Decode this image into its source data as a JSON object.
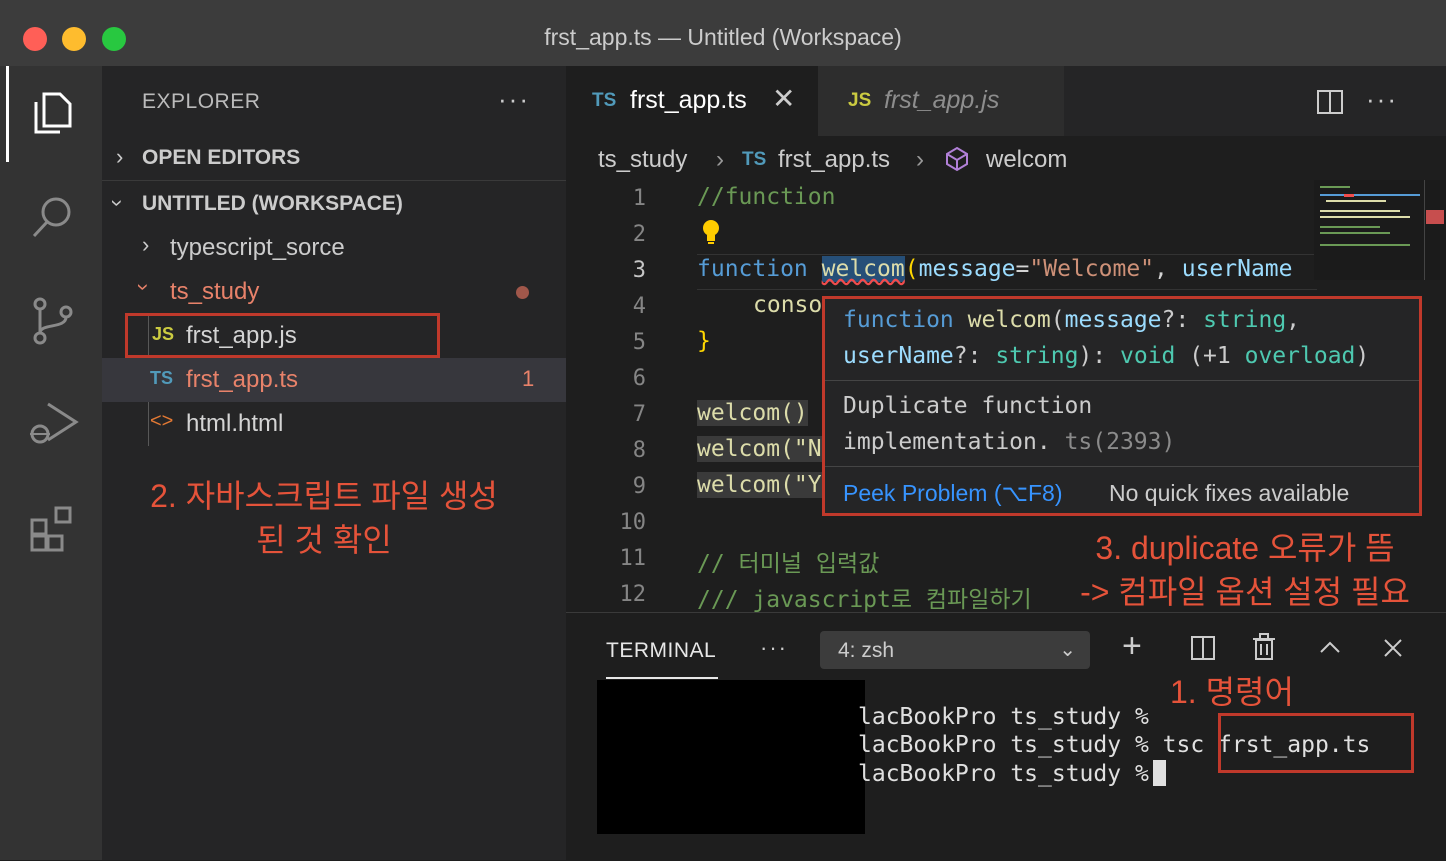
{
  "window": {
    "title": "frst_app.ts — Untitled (Workspace)"
  },
  "sidebar": {
    "title": "EXPLORER",
    "more": "···",
    "open_editors": "OPEN EDITORS",
    "workspace": "UNTITLED (WORKSPACE)",
    "items": [
      {
        "label": "typescript_sorce",
        "type": "folder"
      },
      {
        "label": "ts_study",
        "type": "folder"
      },
      {
        "label": "frst_app.js",
        "icon": "JS"
      },
      {
        "label": "frst_app.ts",
        "icon": "TS",
        "badge": "1"
      },
      {
        "label": "html.html",
        "icon": "<>"
      }
    ]
  },
  "tabs": [
    {
      "label": "frst_app.ts",
      "icon": "TS",
      "close": "✕"
    },
    {
      "label": "frst_app.js",
      "icon": "JS"
    }
  ],
  "breadcrumb": {
    "folder": "ts_study",
    "file_icon": "TS",
    "file": "frst_app.ts",
    "symbol": "welcom"
  },
  "editor": {
    "line_numbers": [
      "1",
      "2",
      "3",
      "4",
      "5",
      "6",
      "7",
      "8",
      "9",
      "10",
      "11",
      "12"
    ],
    "lines": {
      "l1": "//function",
      "l3_kw": "function",
      "l3_fn": "welcom",
      "l3_p1": "message",
      "l3_eq": "=",
      "l3_s1": "\"Welcome\"",
      "l3_comma": ", ",
      "l3_p2": "userName",
      "l4": "conso",
      "l5": "}",
      "l7": "welcom()",
      "l8": "welcom(\"N",
      "l9": "welcom(\"Y",
      "l11": "// 터미널 입력값",
      "l12": "/// javascript로 컴파일하기"
    }
  },
  "hover": {
    "sig_kw": "function",
    "sig_fn": "welcom",
    "sig_p1": "message",
    "sig_colon1": "?: ",
    "sig_t1": "string",
    "sig_comma": ",",
    "sig_p2": "userName",
    "sig_colon2": "?: ",
    "sig_t2": "string",
    "sig_close": "): ",
    "sig_ret": "void",
    "sig_overload_open": " (+1 ",
    "sig_overload": "overload",
    "sig_overload_close": ")",
    "msg_line1": "Duplicate function",
    "msg_line2": "implementation.",
    "msg_code": " ts(2393)",
    "peek": "Peek Problem (⌥F8)",
    "no_fix": "No quick fixes available"
  },
  "panel": {
    "tab": "TERMINAL",
    "more": "···",
    "shell": "4: zsh",
    "lines": [
      "lacBookPro ts_study %",
      "lacBookPro ts_study % tsc frst_app.ts",
      "lacBookPro ts_study %"
    ]
  },
  "annotations": {
    "a1": "1. 명령어",
    "a2_line1": "2. 자바스크립트 파일 생성",
    "a2_line2": "된 것 확인",
    "a3_line1": "3. duplicate 오류가 뜸",
    "a3_line2": "-> 컴파일 옵션 설정 필요"
  },
  "colors": {
    "annotation": "#e5533a",
    "accent": "#3794ff"
  }
}
